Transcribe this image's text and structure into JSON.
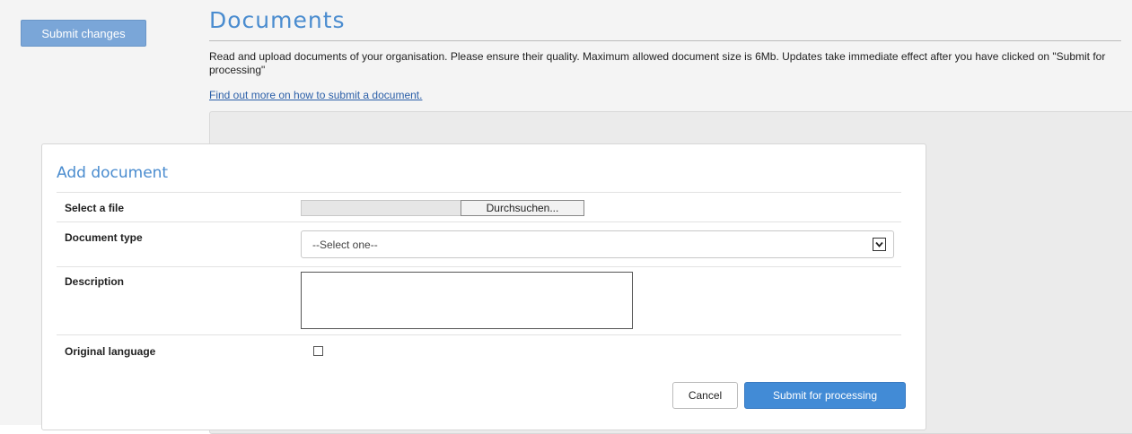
{
  "sidebar": {
    "submit_changes_label": "Submit changes"
  },
  "page": {
    "title": "Documents",
    "intro": "Read and upload documents of your organisation. Please ensure their quality. Maximum allowed document size is 6Mb. Updates take immediate effect after you have clicked on \"Submit for processing\"",
    "help_link": "Find out more on how to submit a document."
  },
  "form": {
    "title": "Add document",
    "file": {
      "label": "Select a file",
      "browse_label": "Durchsuchen..."
    },
    "document_type": {
      "label": "Document type",
      "selected": "--Select one--"
    },
    "description": {
      "label": "Description",
      "value": ""
    },
    "original_language": {
      "label": "Original language",
      "checked": false
    },
    "cancel_label": "Cancel",
    "submit_label": "Submit for processing"
  },
  "icons": {
    "select_chevron": "chevron-down-icon"
  },
  "colors": {
    "accent": "#4a8ccf",
    "primary_button": "#428bd6",
    "secondary_button": "#7aa6d8",
    "link": "#2b5fa8"
  }
}
